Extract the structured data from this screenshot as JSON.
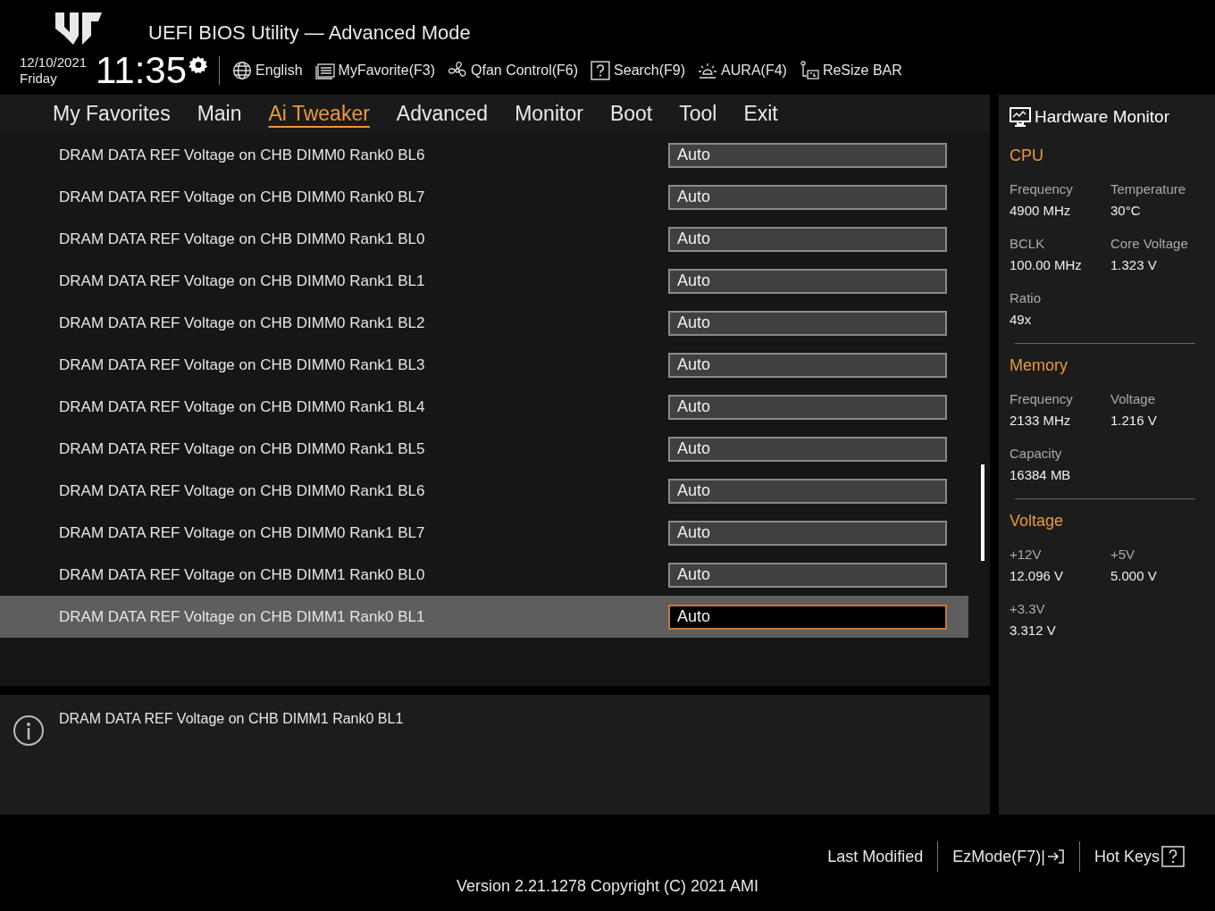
{
  "header": {
    "title": "UEFI BIOS Utility — Advanced Mode",
    "date": "12/10/2021",
    "day": "Friday",
    "time": "11:35",
    "toolbar": [
      {
        "kind": "language",
        "label": "English"
      },
      {
        "kind": "favorite",
        "label": "MyFavorite(F3)"
      },
      {
        "kind": "fan",
        "label": "Qfan Control(F6)"
      },
      {
        "kind": "search",
        "label": "Search(F9)"
      },
      {
        "kind": "aura",
        "label": "AURA(F4)"
      },
      {
        "kind": "resize",
        "label": "ReSize BAR"
      }
    ]
  },
  "tabs": [
    {
      "label": "My Favorites",
      "selected": false
    },
    {
      "label": "Main",
      "selected": false
    },
    {
      "label": "Ai Tweaker",
      "selected": true
    },
    {
      "label": "Advanced",
      "selected": false
    },
    {
      "label": "Monitor",
      "selected": false
    },
    {
      "label": "Boot",
      "selected": false
    },
    {
      "label": "Tool",
      "selected": false
    },
    {
      "label": "Exit",
      "selected": false
    }
  ],
  "settings": [
    {
      "label": "DRAM DATA REF Voltage on CHB DIMM0 Rank0 BL6",
      "value": "Auto",
      "selected": false
    },
    {
      "label": "DRAM DATA REF Voltage on CHB DIMM0 Rank0 BL7",
      "value": "Auto",
      "selected": false
    },
    {
      "label": "DRAM DATA REF Voltage on CHB DIMM0 Rank1 BL0",
      "value": "Auto",
      "selected": false
    },
    {
      "label": "DRAM DATA REF Voltage on CHB DIMM0 Rank1 BL1",
      "value": "Auto",
      "selected": false
    },
    {
      "label": "DRAM DATA REF Voltage on CHB DIMM0 Rank1 BL2",
      "value": "Auto",
      "selected": false
    },
    {
      "label": "DRAM DATA REF Voltage on CHB DIMM0 Rank1 BL3",
      "value": "Auto",
      "selected": false
    },
    {
      "label": "DRAM DATA REF Voltage on CHB DIMM0 Rank1 BL4",
      "value": "Auto",
      "selected": false
    },
    {
      "label": "DRAM DATA REF Voltage on CHB DIMM0 Rank1 BL5",
      "value": "Auto",
      "selected": false
    },
    {
      "label": "DRAM DATA REF Voltage on CHB DIMM0 Rank1 BL6",
      "value": "Auto",
      "selected": false
    },
    {
      "label": "DRAM DATA REF Voltage on CHB DIMM0 Rank1 BL7",
      "value": "Auto",
      "selected": false
    },
    {
      "label": "DRAM DATA REF Voltage on CHB DIMM1 Rank0 BL0",
      "value": "Auto",
      "selected": false
    },
    {
      "label": "DRAM DATA REF Voltage on CHB DIMM1 Rank0 BL1",
      "value": "Auto",
      "selected": true
    }
  ],
  "description": "DRAM DATA REF Voltage on CHB DIMM1 Rank0 BL1",
  "hardware_monitor": {
    "title": "Hardware Monitor",
    "sections": [
      {
        "title": "CPU",
        "items": [
          {
            "label": "Frequency",
            "value": "4900 MHz"
          },
          {
            "label": "Temperature",
            "value": "30°C"
          },
          {
            "label": "BCLK",
            "value": "100.00 MHz"
          },
          {
            "label": "Core Voltage",
            "value": "1.323 V"
          },
          {
            "label": "Ratio",
            "value": "49x"
          }
        ]
      },
      {
        "title": "Memory",
        "items": [
          {
            "label": "Frequency",
            "value": "2133 MHz"
          },
          {
            "label": "Voltage",
            "value": "1.216 V"
          },
          {
            "label": "Capacity",
            "value": "16384 MB"
          }
        ]
      },
      {
        "title": "Voltage",
        "items": [
          {
            "label": "+12V",
            "value": "12.096 V"
          },
          {
            "label": "+5V",
            "value": "5.000 V"
          },
          {
            "label": "+3.3V",
            "value": "3.312 V"
          }
        ]
      }
    ]
  },
  "footer": {
    "buttons": [
      {
        "kind": "plain",
        "label": "Last Modified"
      },
      {
        "kind": "ezmode",
        "label": "EzMode(F7)|"
      },
      {
        "kind": "hotkeys",
        "label": "Hot Keys"
      }
    ],
    "version": "Version 2.21.1278 Copyright (C) 2021 AMI"
  }
}
